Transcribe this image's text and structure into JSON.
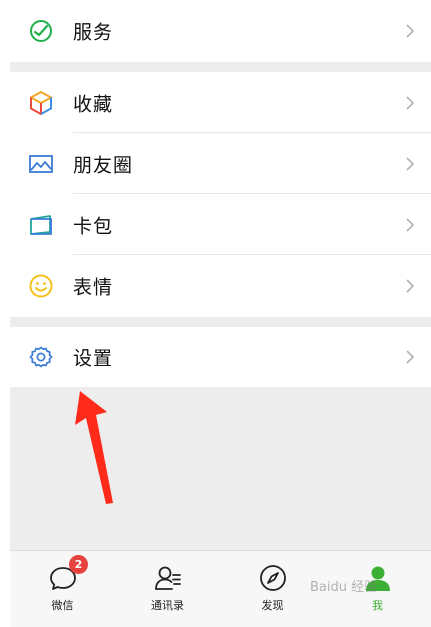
{
  "menu_top": {
    "service_label": "服务"
  },
  "menu_mid": {
    "items": [
      {
        "label": "收藏",
        "icon": "cube-icon"
      },
      {
        "label": "朋友圈",
        "icon": "picture-icon"
      },
      {
        "label": "卡包",
        "icon": "card-wallet-icon"
      },
      {
        "label": "表情",
        "icon": "smiley-icon"
      }
    ]
  },
  "menu_bottom": {
    "settings_label": "设置"
  },
  "tabbar": {
    "tabs": [
      {
        "label": "微信",
        "icon": "chat-bubble-icon",
        "badge": "2"
      },
      {
        "label": "通讯录",
        "icon": "contacts-icon"
      },
      {
        "label": "发现",
        "icon": "compass-icon"
      },
      {
        "label": "我",
        "icon": "person-icon",
        "active": true
      }
    ]
  },
  "watermark": {
    "text": "Baidu 经验"
  },
  "colors": {
    "accent_green": "#3cb034",
    "badge_red": "#e64340",
    "annotation_arrow": "#ff2a1a"
  }
}
